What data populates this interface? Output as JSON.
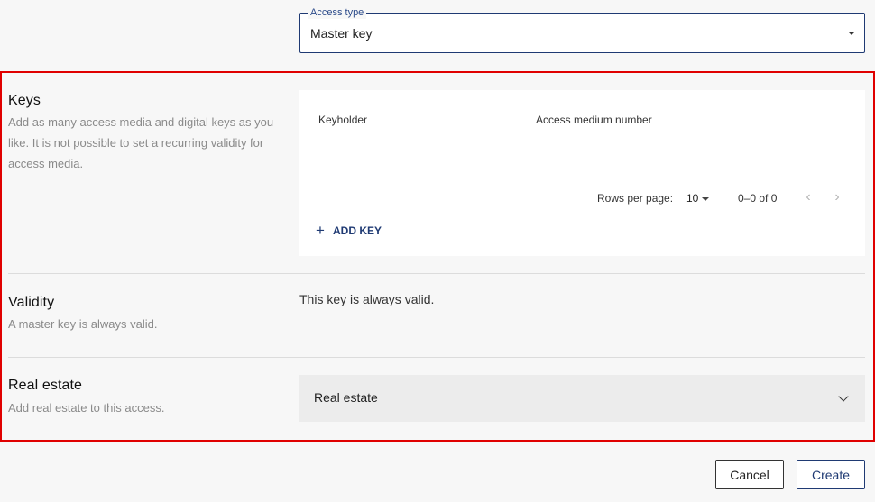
{
  "access_type": {
    "legend": "Access type",
    "value": "Master key"
  },
  "keys": {
    "title": "Keys",
    "description": "Add as many access media and digital keys as you like. It is not possible to set a recurring validity for access media.",
    "columns": [
      "Keyholder",
      "Access medium number"
    ],
    "rows_per_page_label": "Rows per page:",
    "rows_per_page_value": "10",
    "range_text": "0–0 of 0",
    "add_key_label": "ADD KEY"
  },
  "validity": {
    "title": "Validity",
    "description": "A master key is always valid.",
    "value_text": "This key is always valid."
  },
  "real_estate": {
    "title": "Real estate",
    "description": "Add real estate to this access.",
    "select_label": "Real estate"
  },
  "footer": {
    "cancel_label": "Cancel",
    "create_label": "Create"
  },
  "colors": {
    "accent": "#1f3a73",
    "highlight_border": "#e00000"
  }
}
